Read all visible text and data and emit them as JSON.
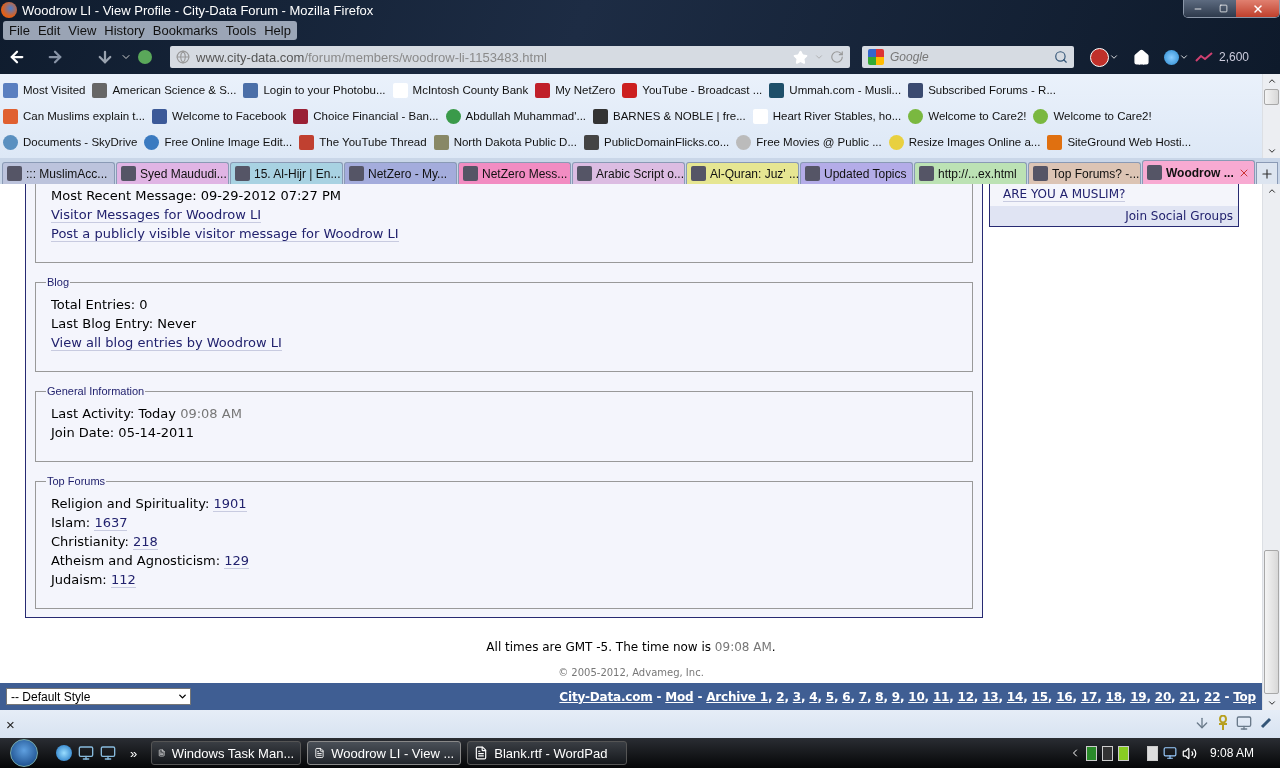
{
  "window": {
    "title": "Woodrow LI - View Profile - City-Data Forum - Mozilla Firefox"
  },
  "menu": [
    "File",
    "Edit",
    "View",
    "History",
    "Bookmarks",
    "Tools",
    "Help"
  ],
  "nav": {
    "url_host": "www.city-data.com",
    "url_path": "/forum/members/woodrow-li-1153483.html",
    "search_placeholder": "Google",
    "counter": "2,600"
  },
  "bookmark_rows": [
    [
      "Most Visited",
      "American Science & S...",
      "Login to your Photobu...",
      "McIntosh County Bank",
      "My NetZero",
      "YouTube - Broadcast ...",
      "Ummah.com - Musli...",
      "Subscribed Forums - R..."
    ],
    [
      "Can Muslims explain t...",
      "Welcome to Facebook",
      "Choice Financial - Ban...",
      "Abdullah Muhammad'...",
      "BARNES & NOBLE | fre...",
      "Heart River Stables, ho...",
      "Welcome to Care2!",
      "Welcome to Care2!"
    ],
    [
      "Documents - SkyDrive",
      "Free Online Image Edit...",
      "The YouTube Thread",
      "North Dakota Public D...",
      "PublicDomainFlicks.co...",
      "Free Movies @ Public ...",
      "Resize Images Online a...",
      "SiteGround Web Hosti..."
    ]
  ],
  "tabs": [
    {
      "label": "::: MuslimAcc...",
      "selected": false,
      "color": "#bcc3dc"
    },
    {
      "label": "Syed Maududi...",
      "selected": false,
      "color": "#e0b4e4"
    },
    {
      "label": "15. Al-Hijr | En...",
      "selected": false,
      "color": "#a8d2e2"
    },
    {
      "label": "NetZero - My...",
      "selected": false,
      "color": "#a4acdc"
    },
    {
      "label": "NetZero Mess...",
      "selected": false,
      "color": "#f28cc2"
    },
    {
      "label": "Arabic Script o...",
      "selected": false,
      "color": "#dcbce2"
    },
    {
      "label": "Al-Quran: Juz' ...",
      "selected": false,
      "color": "#e6e692"
    },
    {
      "label": "Updated Topics",
      "selected": false,
      "color": "#b4ace8"
    },
    {
      "label": "http://...ex.html",
      "selected": false,
      "color": "#bce2b4"
    },
    {
      "label": "Top Forums? -...",
      "selected": false,
      "color": "#dcc4b4"
    },
    {
      "label": "Woodrow ...",
      "selected": true,
      "color": "#f8aad2"
    }
  ],
  "sections": [
    {
      "lines": [
        {
          "kind": "text",
          "text": "Most Recent Message: 09-29-2012 07:27 PM"
        },
        {
          "kind": "link",
          "text": "Visitor Messages for Woodrow LI"
        },
        {
          "kind": "link",
          "text": "Post a publicly visible visitor message for Woodrow LI"
        }
      ]
    },
    {
      "title": "Blog",
      "lines": [
        {
          "kind": "text",
          "text": "Total Entries: 0"
        },
        {
          "kind": "text",
          "text": "Last Blog Entry: Never"
        },
        {
          "kind": "link",
          "text": "View all blog entries by Woodrow LI"
        }
      ]
    },
    {
      "title": "General Information",
      "lines": [
        {
          "kind": "time",
          "label": "Last Activity: Today",
          "value": "09:08 AM"
        },
        {
          "kind": "text",
          "text": "Join Date: 05-14-2011"
        }
      ]
    },
    {
      "title": "Top Forums",
      "lines": [
        {
          "kind": "count",
          "label": "Religion and Spirituality:",
          "value": "1901"
        },
        {
          "kind": "count",
          "label": "Islam:",
          "value": "1637"
        },
        {
          "kind": "count",
          "label": "Christianity:",
          "value": "218"
        },
        {
          "kind": "count",
          "label": "Atheism and Agnosticism:",
          "value": "129"
        },
        {
          "kind": "count",
          "label": "Judaism:",
          "value": "112"
        }
      ]
    }
  ],
  "sidebar": {
    "group_link": "ARE YOU A MUSLIM?",
    "footer_link": "Join Social Groups"
  },
  "footer": {
    "time_before": "All times are GMT -5. The time now is ",
    "time": "09:08 AM",
    "time_after": ".",
    "copyright": "© 2005-2012, Advameg, Inc.",
    "style_select": "-- Default Style",
    "links": [
      {
        "text": "City-Data.com",
        "after": " - "
      },
      {
        "text": "Mod",
        "after": " - "
      },
      {
        "text": "Archive 1",
        "after": ", "
      },
      {
        "text": "2",
        "after": ", "
      },
      {
        "text": "3",
        "after": ", "
      },
      {
        "text": "4",
        "after": ", "
      },
      {
        "text": "5",
        "after": ", "
      },
      {
        "text": "6",
        "after": ", "
      },
      {
        "text": "7",
        "after": ", "
      },
      {
        "text": "8",
        "after": ", "
      },
      {
        "text": "9",
        "after": ", "
      },
      {
        "text": "10",
        "after": ", "
      },
      {
        "text": "11",
        "after": ", "
      },
      {
        "text": "12",
        "after": ", "
      },
      {
        "text": "13",
        "after": ", "
      },
      {
        "text": "14",
        "after": ", "
      },
      {
        "text": "15",
        "after": ", "
      },
      {
        "text": "16",
        "after": ", "
      },
      {
        "text": "17",
        "after": ", "
      },
      {
        "text": "18",
        "after": ", "
      },
      {
        "text": "19",
        "after": ", "
      },
      {
        "text": "20",
        "after": ", "
      },
      {
        "text": "21",
        "after": ", "
      },
      {
        "text": "22",
        "after": " - "
      },
      {
        "text": "Top"
      }
    ]
  },
  "status_bar": {
    "close": "×"
  },
  "taskbar": {
    "tasks": [
      {
        "label": "Windows Task Man...",
        "selected": false
      },
      {
        "label": "Woodrow LI - View ...",
        "selected": true
      },
      {
        "label": "Blank.rtf - WordPad",
        "selected": false
      }
    ],
    "more": "»",
    "clock": "9:08 AM"
  }
}
